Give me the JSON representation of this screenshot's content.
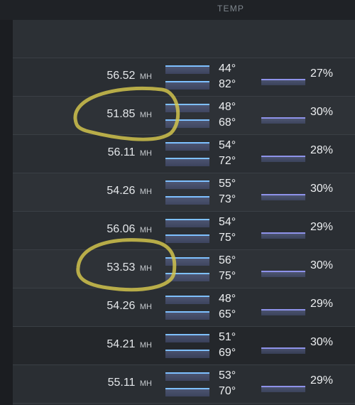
{
  "header": {
    "temp_label": "TEMP"
  },
  "rows": [
    {
      "hashrate": "56.52",
      "unit": "MH",
      "temp_top": "44°",
      "temp_bottom": "82°",
      "fan": "27%"
    },
    {
      "hashrate": "51.85",
      "unit": "MH",
      "temp_top": "48°",
      "temp_bottom": "68°",
      "fan": "30%"
    },
    {
      "hashrate": "56.11",
      "unit": "MH",
      "temp_top": "54°",
      "temp_bottom": "72°",
      "fan": "28%"
    },
    {
      "hashrate": "54.26",
      "unit": "MH",
      "temp_top": "55°",
      "temp_bottom": "73°",
      "fan": "30%"
    },
    {
      "hashrate": "56.06",
      "unit": "MH",
      "temp_top": "54°",
      "temp_bottom": "75°",
      "fan": "29%"
    },
    {
      "hashrate": "53.53",
      "unit": "MH",
      "temp_top": "56°",
      "temp_bottom": "75°",
      "fan": "30%"
    },
    {
      "hashrate": "54.26",
      "unit": "MH",
      "temp_top": "48°",
      "temp_bottom": "65°",
      "fan": "29%"
    },
    {
      "hashrate": "54.21",
      "unit": "MH",
      "temp_top": "51°",
      "temp_bottom": "69°",
      "fan": "30%"
    },
    {
      "hashrate": "55.11",
      "unit": "MH",
      "temp_top": "53°",
      "temp_bottom": "70°",
      "fan": "29%"
    }
  ],
  "colors": {
    "annotation": "#d7c84d",
    "sparkline_line": "#7ec0ff",
    "fan_sparkline_line": "#8e92ea"
  }
}
